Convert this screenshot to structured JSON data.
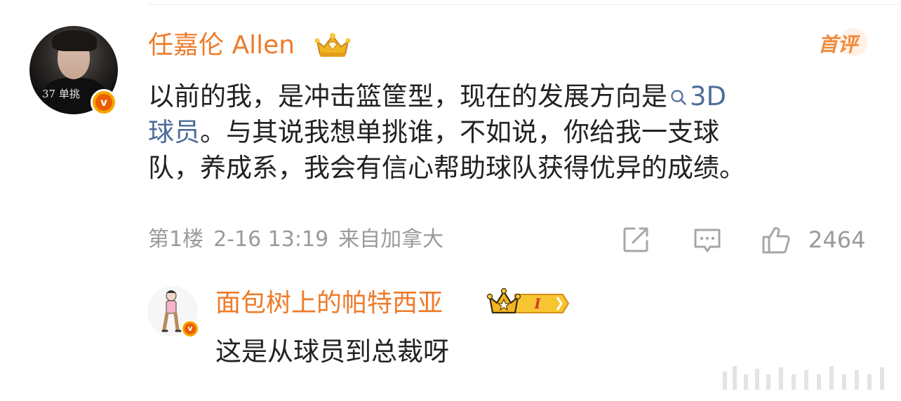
{
  "main_comment": {
    "avatar_overlay_text": "37 单挑",
    "username": "任嘉伦 Allen",
    "first_comment_badge": "首评",
    "text_lines": [
      {
        "before": "以前的我，是冲击篮筐型，现在的发展方向是",
        "tag": "3D"
      },
      {
        "tag_end": "球员",
        "after": "。与其说我想单挑谁，不如说，你给我一支球"
      },
      {
        "text": "队，养成系，我会有信心帮助球队获得优异的成绩。"
      }
    ],
    "floor": "第1楼",
    "time": "2-16 13:19",
    "location": "来自加拿大",
    "like_count": "2464"
  },
  "reply": {
    "username": "面包树上的帕特西亚",
    "vip_level": "I",
    "text": "这是从球员到总裁呀"
  },
  "icons": {
    "share": "share-icon",
    "reply": "comment-icon",
    "like": "thumbs-up-icon",
    "verified": "verified-v-icon",
    "search": "search-icon",
    "crown": "crown-icon"
  },
  "colors": {
    "username": "#ee7b2a",
    "link": "#4f6d9b",
    "meta": "#9a9a9a",
    "text": "#222222",
    "verified_outer": "#f7a700",
    "verified_inner": "#ea5e00"
  },
  "verified_mark": "v"
}
